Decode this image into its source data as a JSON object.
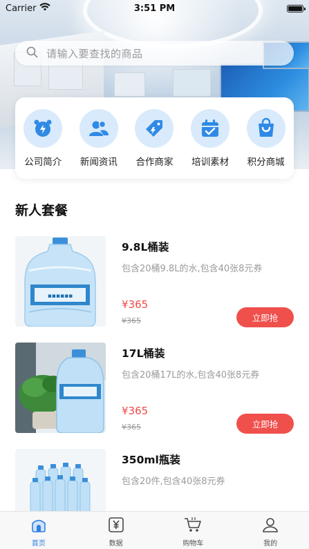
{
  "status_bar": {
    "carrier": "Carrier",
    "time": "3:51 PM"
  },
  "search": {
    "placeholder": "请输入要查找的商品"
  },
  "quick_nav": [
    {
      "label": "公司简介",
      "icon": "alarm-clock-icon"
    },
    {
      "label": "新闻资讯",
      "icon": "users-icon"
    },
    {
      "label": "合作商家",
      "icon": "tag-icon"
    },
    {
      "label": "培训素材",
      "icon": "calendar-check-icon"
    },
    {
      "label": "积分商城",
      "icon": "shopping-bag-icon"
    }
  ],
  "section": {
    "title": "新人套餐"
  },
  "products": [
    {
      "name": "9.8L桶装",
      "desc": "包含20桶9.8L的水,包含40张8元券",
      "price": "¥365",
      "original_price": "¥365",
      "button": "立即抢"
    },
    {
      "name": "17L桶装",
      "desc": "包含20桶17L的水,包含40张8元券",
      "price": "¥365",
      "original_price": "¥365",
      "button": "立即抢"
    },
    {
      "name": "350ml瓶装",
      "desc": "包含20件,包含40张8元券",
      "price": "",
      "original_price": "",
      "button": ""
    }
  ],
  "tabbar": [
    {
      "label": "首页",
      "icon": "home-icon",
      "active": true
    },
    {
      "label": "数据",
      "icon": "data-yen-icon",
      "active": false
    },
    {
      "label": "购物车",
      "icon": "cart-icon",
      "active": false
    },
    {
      "label": "我的",
      "icon": "user-icon",
      "active": false
    }
  ],
  "colors": {
    "accent_blue": "#2f7fe0",
    "price_red": "#f04848",
    "button_red": "#f0504c",
    "icon_bg": "#d8eafb"
  }
}
